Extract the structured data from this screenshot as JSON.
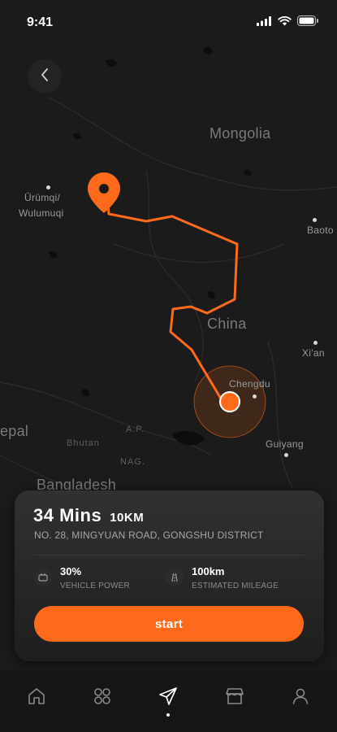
{
  "status_bar": {
    "time": "9:41"
  },
  "map": {
    "labels": {
      "mongolia": "Mongolia",
      "urumqi_1": "Ürümqi/",
      "urumqi_2": "Wulumuqi",
      "baotou": "Baoto",
      "china": "China",
      "xian": "Xi'an",
      "chengdu": "Chengdu",
      "guiyang": "Guiyang",
      "nepal": "epal",
      "bhutan": "Bhutan",
      "ap": "A.P.",
      "nag": "NAG.",
      "bangladesh": "Bangladesh"
    },
    "route_color": "#ff6a1a"
  },
  "trip": {
    "duration": "34 Mins",
    "distance": "10KM",
    "address": "NO. 28, MINGYUAN ROAD, GONGSHU DISTRICT",
    "vehicle_power": {
      "value": "30%",
      "label": "VEHICLE POWER",
      "icon": "battery-icon"
    },
    "estimated_mileage": {
      "value": "100km",
      "label": "ESTIMATED MILEAGE",
      "icon": "road-icon"
    },
    "start_label": "start"
  },
  "tabbar": {
    "items": [
      {
        "icon": "home-icon"
      },
      {
        "icon": "grid-icon"
      },
      {
        "icon": "navigation-icon",
        "active": true
      },
      {
        "icon": "store-icon"
      },
      {
        "icon": "profile-icon"
      }
    ]
  },
  "colors": {
    "accent": "#ff6a1a",
    "background": "#1b1b1b",
    "card": "#2a2a2a"
  }
}
